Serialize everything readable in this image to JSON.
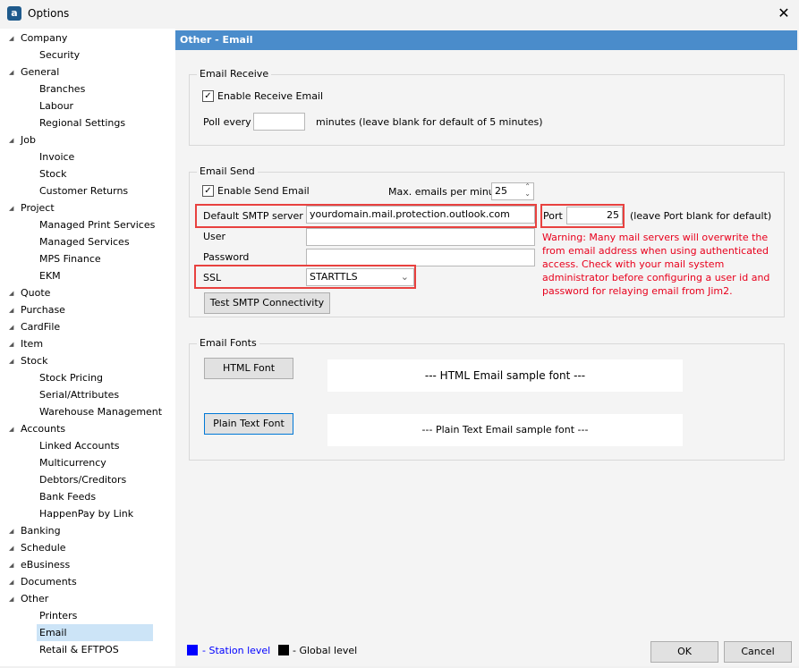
{
  "window": {
    "title": "Options",
    "close": "✕"
  },
  "sidebar": {
    "items": [
      {
        "label": "Company",
        "level": 0
      },
      {
        "label": "Security",
        "level": 1
      },
      {
        "label": "General",
        "level": 0
      },
      {
        "label": "Branches",
        "level": 1
      },
      {
        "label": "Labour",
        "level": 1
      },
      {
        "label": "Regional Settings",
        "level": 1
      },
      {
        "label": "Job",
        "level": 0
      },
      {
        "label": "Invoice",
        "level": 1
      },
      {
        "label": "Stock",
        "level": 1
      },
      {
        "label": "Customer Returns",
        "level": 1
      },
      {
        "label": "Project",
        "level": 0
      },
      {
        "label": "Managed Print Services",
        "level": 1
      },
      {
        "label": "Managed Services",
        "level": 1
      },
      {
        "label": "MPS Finance",
        "level": 1
      },
      {
        "label": "EKM",
        "level": 1
      },
      {
        "label": "Quote",
        "level": 0
      },
      {
        "label": "Purchase",
        "level": 0
      },
      {
        "label": "CardFile",
        "level": 0
      },
      {
        "label": "Item",
        "level": 0
      },
      {
        "label": "Stock",
        "level": 0
      },
      {
        "label": "Stock Pricing",
        "level": 1
      },
      {
        "label": "Serial/Attributes",
        "level": 1
      },
      {
        "label": "Warehouse Management",
        "level": 1
      },
      {
        "label": "Accounts",
        "level": 0
      },
      {
        "label": "Linked Accounts",
        "level": 1
      },
      {
        "label": "Multicurrency",
        "level": 1
      },
      {
        "label": "Debtors/Creditors",
        "level": 1
      },
      {
        "label": "Bank Feeds",
        "level": 1
      },
      {
        "label": "HappenPay by Link",
        "level": 1
      },
      {
        "label": "Banking",
        "level": 0
      },
      {
        "label": "Schedule",
        "level": 0
      },
      {
        "label": "eBusiness",
        "level": 0
      },
      {
        "label": "Documents",
        "level": 0
      },
      {
        "label": "Other",
        "level": 0
      },
      {
        "label": "Printers",
        "level": 1
      },
      {
        "label": "Email",
        "level": 1,
        "selected": true
      },
      {
        "label": "Retail & EFTPOS",
        "level": 1
      }
    ]
  },
  "header": {
    "title": "Other - Email"
  },
  "receive": {
    "legend": "Email Receive",
    "enable_label": "Enable Receive Email",
    "enable_checked": true,
    "poll_label": "Poll every",
    "poll_value": "",
    "poll_hint": "minutes (leave blank for default of 5 minutes)"
  },
  "send": {
    "legend": "Email Send",
    "enable_label": "Enable Send Email",
    "enable_checked": true,
    "max_label": "Max. emails per minute",
    "max_value": "25",
    "smtp_label": "Default SMTP server",
    "smtp_value": "yourdomain.mail.protection.outlook.com",
    "port_label": "Port",
    "port_value": "25",
    "port_hint": "(leave Port blank for default)",
    "user_label": "User",
    "user_value": "",
    "password_label": "Password",
    "password_value": "",
    "ssl_label": "SSL",
    "ssl_value": "STARTTLS",
    "warning": "Warning: Many mail servers will overwrite the from email address when using authenticated access. Check with your mail system administrator before configuring a user id and password for relaying email from Jim2.",
    "test_button": "Test SMTP Connectivity"
  },
  "fonts": {
    "legend": "Email Fonts",
    "html_button": "HTML Font",
    "html_sample": "--- HTML Email sample font ---",
    "plain_button": "Plain Text Font",
    "plain_sample": "--- Plain Text Email sample font ---"
  },
  "footer": {
    "station_label": "- Station level",
    "station_color": "#0000ff",
    "global_label": "- Global level",
    "global_color": "#000000",
    "ok": "OK",
    "cancel": "Cancel"
  },
  "colors": {
    "header": "#4a8ccb",
    "highlight": "#e8413f",
    "warning": "#e8001c"
  }
}
